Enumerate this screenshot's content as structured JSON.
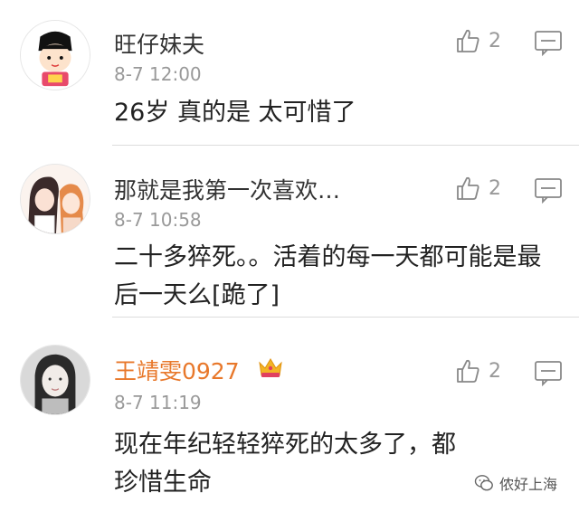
{
  "comments": [
    {
      "username": "旺仔妹夫",
      "time": "8-7 12:00",
      "content": "26岁 真的是 太可惜了",
      "likes": "2",
      "avatar_icon": "cartoon-boy-avatar"
    },
    {
      "username": "那就是我第一次喜欢…",
      "time": "8-7 10:58",
      "content": "二十多猝死。。活着的每一天都可能是最后一天么[跪了]",
      "likes": "2",
      "avatar_icon": "anime-couple-avatar"
    },
    {
      "username": "王靖雯0927",
      "time": "8-7 11:19",
      "content": "现在年纪轻轻猝死的太多了，都珍惜生命",
      "likes": "2",
      "avatar_icon": "girl-photo-avatar",
      "badge_icon": "crown-vip-icon"
    }
  ],
  "watermark": {
    "text": "侬好上海"
  },
  "colors": {
    "vip_name": "#e8782b",
    "time": "#999999",
    "divider": "#dcdcdc"
  }
}
